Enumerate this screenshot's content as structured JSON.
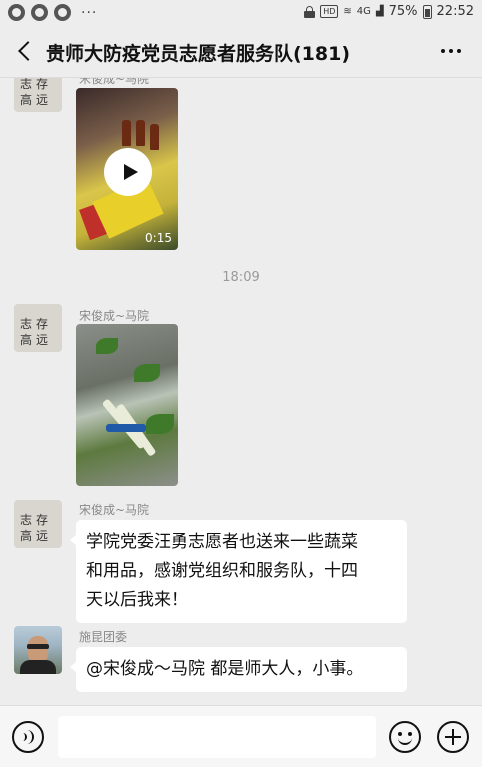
{
  "status_bar": {
    "battery": "75%",
    "time": "22:52",
    "network_badge": "HD",
    "signal": "4G"
  },
  "header": {
    "title": "贵师大防疫党员志愿者服务队(181)"
  },
  "messages": [
    {
      "type": "video",
      "sender": "宋俊成~马院",
      "duration": "0:15"
    },
    {
      "type": "timestamp",
      "text": "18:09"
    },
    {
      "type": "image",
      "sender": "宋俊成~马院"
    },
    {
      "type": "text",
      "sender": "宋俊成~马院",
      "lines": [
        "学院党委汪勇志愿者也送来一些蔬菜",
        "和用品，感谢党组织和服务队，十四",
        "天以后我来！"
      ]
    },
    {
      "type": "text",
      "sender": "施昆团委",
      "lines": [
        "@宋俊成～马院  都是师大人，小事。"
      ]
    }
  ],
  "avatar_calligraphy": [
    "志",
    "存",
    "高",
    "远"
  ],
  "icons": {
    "back": "back-arrow-icon",
    "more": "more-dots-icon",
    "voice": "voice-icon",
    "emoji": "emoji-icon",
    "plus": "plus-icon",
    "play": "play-icon"
  },
  "colors": {
    "background": "#ededed",
    "bubble": "#ffffff",
    "input_bar": "#f6f6f6"
  }
}
